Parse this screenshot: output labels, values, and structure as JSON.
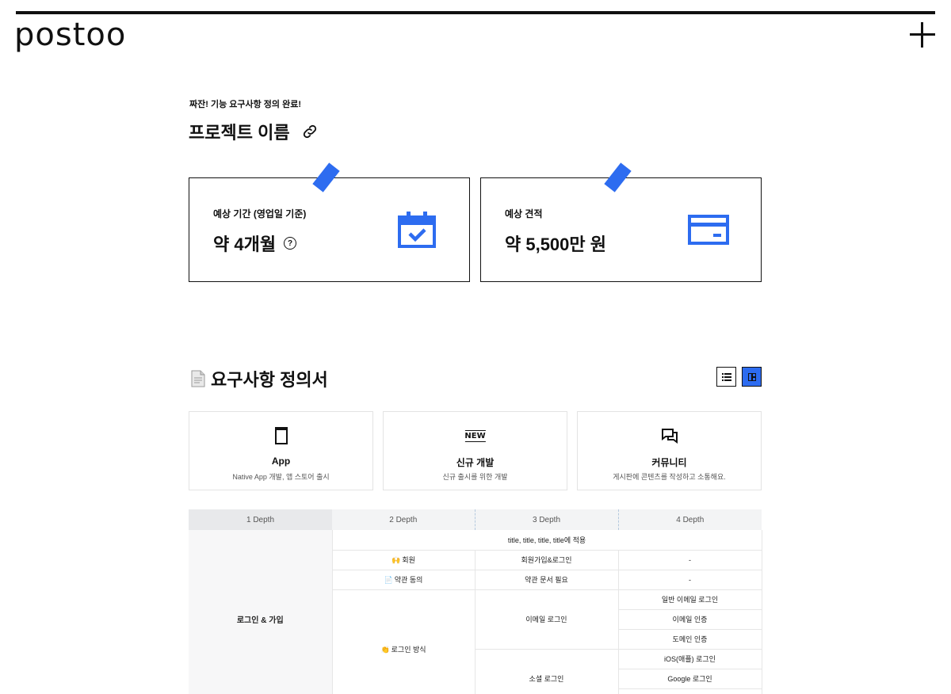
{
  "brand": {
    "logo": "postoo"
  },
  "header": {
    "subtitle": "짜잔! 기능 요구사항 정의 완료!",
    "project_name": "프로젝트 이름"
  },
  "cards": [
    {
      "label": "예상 기간 (영업일 기준)",
      "value": "약 4개월",
      "help_glyph": "?"
    },
    {
      "label": "예상 견적",
      "value": "약 5,500만 원"
    }
  ],
  "accent_color": "#2d6cf0",
  "section": {
    "icon": "📄",
    "title": "요구사항 정의서"
  },
  "features": [
    {
      "icon": "phone-icon",
      "title": "App",
      "desc": "Native App 개발, 앱 스토어 출시"
    },
    {
      "icon": "new-icon",
      "icon_text": "NEW",
      "title": "신규 개발",
      "desc": "신규 출시를 위한 개발"
    },
    {
      "icon": "chat-icon",
      "title": "커뮤니티",
      "desc": "게시판에 콘텐츠를 작성하고 소통해요."
    }
  ],
  "table": {
    "headers": [
      "1 Depth",
      "2 Depth",
      "3 Depth",
      "4 Depth"
    ],
    "depth1": "로그인 & 가입",
    "banner": "title, title, title, title에 적용",
    "rows": {
      "member": {
        "emoji": "🙌",
        "d2": "회원",
        "d3": "회원가입&로그인",
        "d4": "-"
      },
      "terms": {
        "emoji": "📄",
        "d2": "약관 동의",
        "d3": "약관 문서 필요",
        "d4": "-"
      },
      "login_method": {
        "emoji": "👏",
        "d2": "로그인 방식"
      },
      "email_login": {
        "d3": "이메일 로그인",
        "d4": [
          "일반 이메일 로그인",
          "이메일 인증",
          "도메인 인증"
        ]
      },
      "social_login": {
        "d3": "소셜 로그인",
        "d4": [
          "iOS(애플) 로그인",
          "Google 로그인"
        ]
      }
    }
  }
}
